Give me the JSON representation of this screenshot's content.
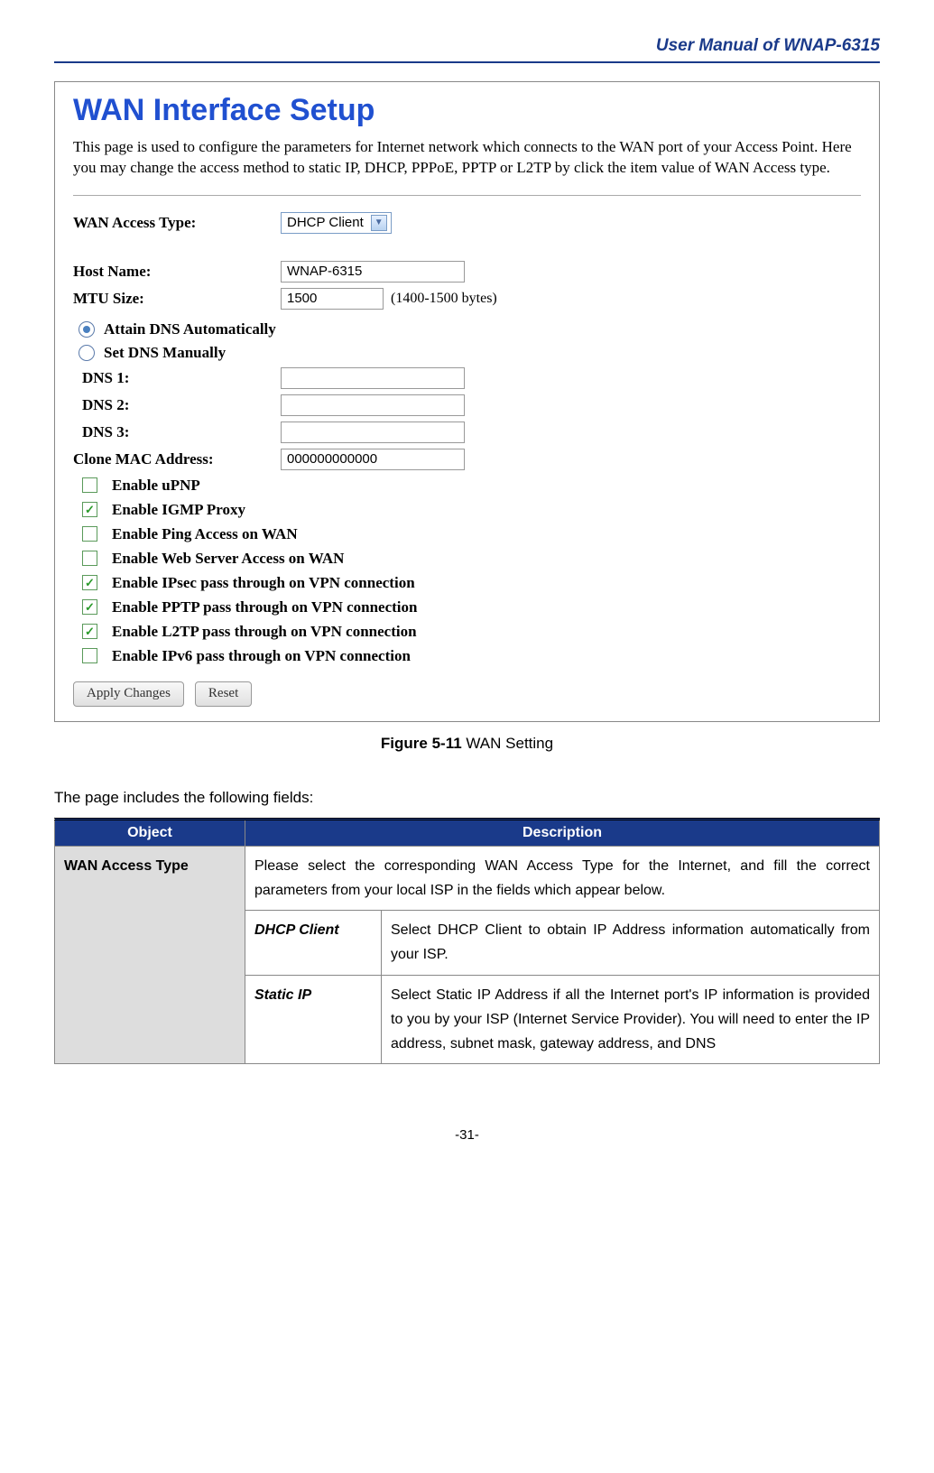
{
  "header": {
    "title": "User Manual of WNAP-6315"
  },
  "screenshot": {
    "title": "WAN Interface Setup",
    "desc": "This page is used to configure the parameters for Internet network which connects to the WAN port of your Access Point. Here you may change the access method to static IP, DHCP, PPPoE, PPTP or L2TP by click the item value of WAN Access type.",
    "access_label": "WAN Access Type:",
    "access_value": "DHCP Client",
    "host_label": "Host Name:",
    "host_value": "WNAP-6315",
    "mtu_label": "MTU Size:",
    "mtu_value": "1500",
    "mtu_hint": "(1400-1500 bytes)",
    "radio_auto": "Attain DNS Automatically",
    "radio_manual": "Set DNS Manually",
    "dns1_label": "DNS 1:",
    "dns2_label": "DNS 2:",
    "dns3_label": "DNS 3:",
    "clone_label": "Clone MAC Address:",
    "clone_value": "000000000000",
    "cb": [
      {
        "label": "Enable uPNP",
        "checked": false
      },
      {
        "label": "Enable IGMP Proxy",
        "checked": true
      },
      {
        "label": "Enable Ping Access on WAN",
        "checked": false
      },
      {
        "label": "Enable Web Server Access on WAN",
        "checked": false
      },
      {
        "label": "Enable IPsec pass through on VPN connection",
        "checked": true
      },
      {
        "label": "Enable PPTP pass through on VPN connection",
        "checked": true
      },
      {
        "label": "Enable L2TP pass through on VPN connection",
        "checked": true
      },
      {
        "label": "Enable IPv6 pass through on VPN connection",
        "checked": false
      }
    ],
    "btn_apply": "Apply Changes",
    "btn_reset": "Reset"
  },
  "caption": {
    "bold": "Figure 5-11",
    "rest": " WAN Setting"
  },
  "intro": "The page includes the following fields:",
  "table": {
    "h1": "Object",
    "h2": "Description",
    "r1_obj": "WAN Access Type",
    "r1_desc": "Please select the corresponding WAN Access Type for the Internet, and fill the correct parameters from your local ISP in the fields which appear below.",
    "r2_obj": "DHCP Client",
    "r2_desc": "Select DHCP Client to obtain IP Address information automatically from your ISP.",
    "r3_obj": "Static IP",
    "r3_desc": "Select Static IP Address if all the Internet port's IP information is provided to you by your ISP (Internet Service Provider). You will need to enter the IP address, subnet mask, gateway address, and DNS"
  },
  "footer": "-31-"
}
